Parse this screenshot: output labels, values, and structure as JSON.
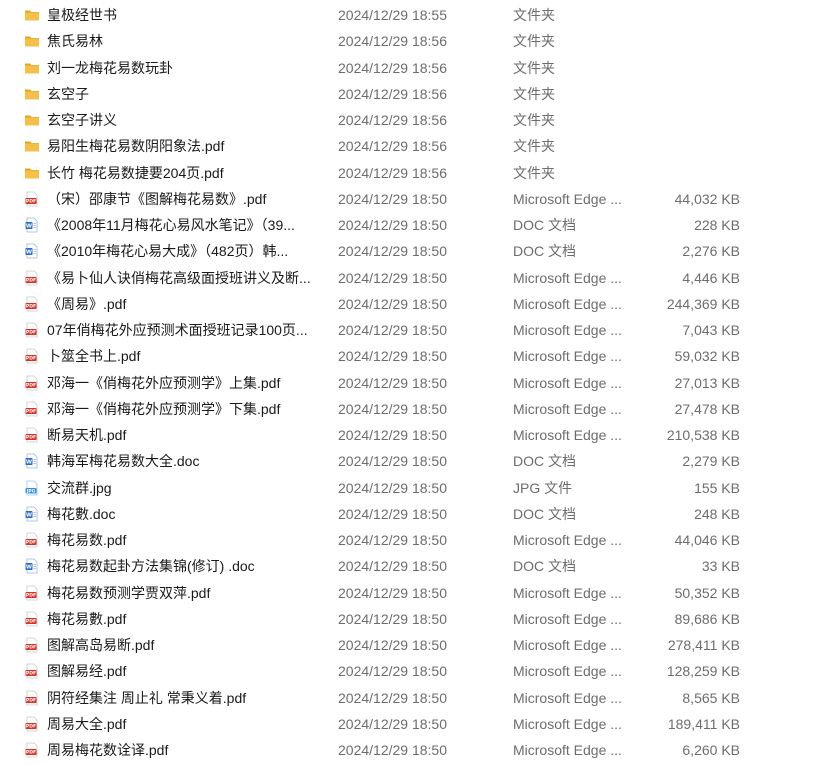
{
  "files": [
    {
      "icon": "folder-icon",
      "name": "皇极经世书",
      "date": "2024/12/29 18:55",
      "type": "文件夹",
      "size": ""
    },
    {
      "icon": "folder-icon",
      "name": "焦氏易林",
      "date": "2024/12/29 18:56",
      "type": "文件夹",
      "size": ""
    },
    {
      "icon": "folder-icon",
      "name": "刘一龙梅花易数玩卦",
      "date": "2024/12/29 18:56",
      "type": "文件夹",
      "size": ""
    },
    {
      "icon": "folder-icon",
      "name": "玄空子",
      "date": "2024/12/29 18:56",
      "type": "文件夹",
      "size": ""
    },
    {
      "icon": "folder-icon",
      "name": "玄空子讲义",
      "date": "2024/12/29 18:56",
      "type": "文件夹",
      "size": ""
    },
    {
      "icon": "folder-icon",
      "name": "易阳生梅花易数阴阳象法.pdf",
      "date": "2024/12/29 18:56",
      "type": "文件夹",
      "size": ""
    },
    {
      "icon": "folder-icon",
      "name": "长竹 梅花易数捷要204页.pdf",
      "date": "2024/12/29 18:56",
      "type": "文件夹",
      "size": ""
    },
    {
      "icon": "pdf-icon",
      "name": "（宋）邵康节《图解梅花易数》.pdf",
      "date": "2024/12/29 18:50",
      "type": "Microsoft Edge ...",
      "size": "44,032 KB"
    },
    {
      "icon": "doc-icon",
      "name": "《2008年11月梅花心易风水笔记》（39...",
      "date": "2024/12/29 18:50",
      "type": "DOC 文档",
      "size": "228 KB"
    },
    {
      "icon": "doc-icon",
      "name": "《2010年梅花心易大成》（482页）韩...",
      "date": "2024/12/29 18:50",
      "type": "DOC 文档",
      "size": "2,276 KB"
    },
    {
      "icon": "pdf-icon",
      "name": "《易卜仙人诀俏梅花高级面授班讲义及断...",
      "date": "2024/12/29 18:50",
      "type": "Microsoft Edge ...",
      "size": "4,446 KB"
    },
    {
      "icon": "pdf-icon",
      "name": "《周易》.pdf",
      "date": "2024/12/29 18:50",
      "type": "Microsoft Edge ...",
      "size": "244,369 KB"
    },
    {
      "icon": "pdf-icon",
      "name": "07年俏梅花外应预测术面授班记录100页...",
      "date": "2024/12/29 18:50",
      "type": "Microsoft Edge ...",
      "size": "7,043 KB"
    },
    {
      "icon": "pdf-icon",
      "name": "卜筮全书上.pdf",
      "date": "2024/12/29 18:50",
      "type": "Microsoft Edge ...",
      "size": "59,032 KB"
    },
    {
      "icon": "pdf-icon",
      "name": "邓海一《俏梅花外应预测学》上集.pdf",
      "date": "2024/12/29 18:50",
      "type": "Microsoft Edge ...",
      "size": "27,013 KB"
    },
    {
      "icon": "pdf-icon",
      "name": "邓海一《俏梅花外应预测学》下集.pdf",
      "date": "2024/12/29 18:50",
      "type": "Microsoft Edge ...",
      "size": "27,478 KB"
    },
    {
      "icon": "pdf-icon",
      "name": "断易天机.pdf",
      "date": "2024/12/29 18:50",
      "type": "Microsoft Edge ...",
      "size": "210,538 KB"
    },
    {
      "icon": "doc-icon",
      "name": "韩海军梅花易数大全.doc",
      "date": "2024/12/29 18:50",
      "type": "DOC 文档",
      "size": "2,279 KB"
    },
    {
      "icon": "jpg-icon",
      "name": "交流群.jpg",
      "date": "2024/12/29 18:50",
      "type": "JPG 文件",
      "size": "155 KB"
    },
    {
      "icon": "doc-icon",
      "name": "梅花數.doc",
      "date": "2024/12/29 18:50",
      "type": "DOC 文档",
      "size": "248 KB"
    },
    {
      "icon": "pdf-icon",
      "name": "梅花易数.pdf",
      "date": "2024/12/29 18:50",
      "type": "Microsoft Edge ...",
      "size": "44,046 KB"
    },
    {
      "icon": "doc-icon",
      "name": "梅花易数起卦方法集锦(修订) .doc",
      "date": "2024/12/29 18:50",
      "type": "DOC 文档",
      "size": "33 KB"
    },
    {
      "icon": "pdf-icon",
      "name": "梅花易数预测学贾双萍.pdf",
      "date": "2024/12/29 18:50",
      "type": "Microsoft Edge ...",
      "size": "50,352 KB"
    },
    {
      "icon": "pdf-icon",
      "name": "梅花易數.pdf",
      "date": "2024/12/29 18:50",
      "type": "Microsoft Edge ...",
      "size": "89,686 KB"
    },
    {
      "icon": "pdf-icon",
      "name": "图解高岛易断.pdf",
      "date": "2024/12/29 18:50",
      "type": "Microsoft Edge ...",
      "size": "278,411 KB"
    },
    {
      "icon": "pdf-icon",
      "name": "图解易经.pdf",
      "date": "2024/12/29 18:50",
      "type": "Microsoft Edge ...",
      "size": "128,259 KB"
    },
    {
      "icon": "pdf-icon",
      "name": "阴符经集注 周止礼 常秉义着.pdf",
      "date": "2024/12/29 18:50",
      "type": "Microsoft Edge ...",
      "size": "8,565 KB"
    },
    {
      "icon": "pdf-icon",
      "name": "周易大全.pdf",
      "date": "2024/12/29 18:50",
      "type": "Microsoft Edge ...",
      "size": "189,411 KB"
    },
    {
      "icon": "pdf-icon",
      "name": "周易梅花数诠译.pdf",
      "date": "2024/12/29 18:50",
      "type": "Microsoft Edge ...",
      "size": "6,260 KB"
    }
  ],
  "colors": {
    "folder": "#F5C04A",
    "folder_tab": "#E0A526",
    "pdf": "#D93025",
    "doc": "#2B6CC4",
    "jpg": "#3B8FE0"
  }
}
